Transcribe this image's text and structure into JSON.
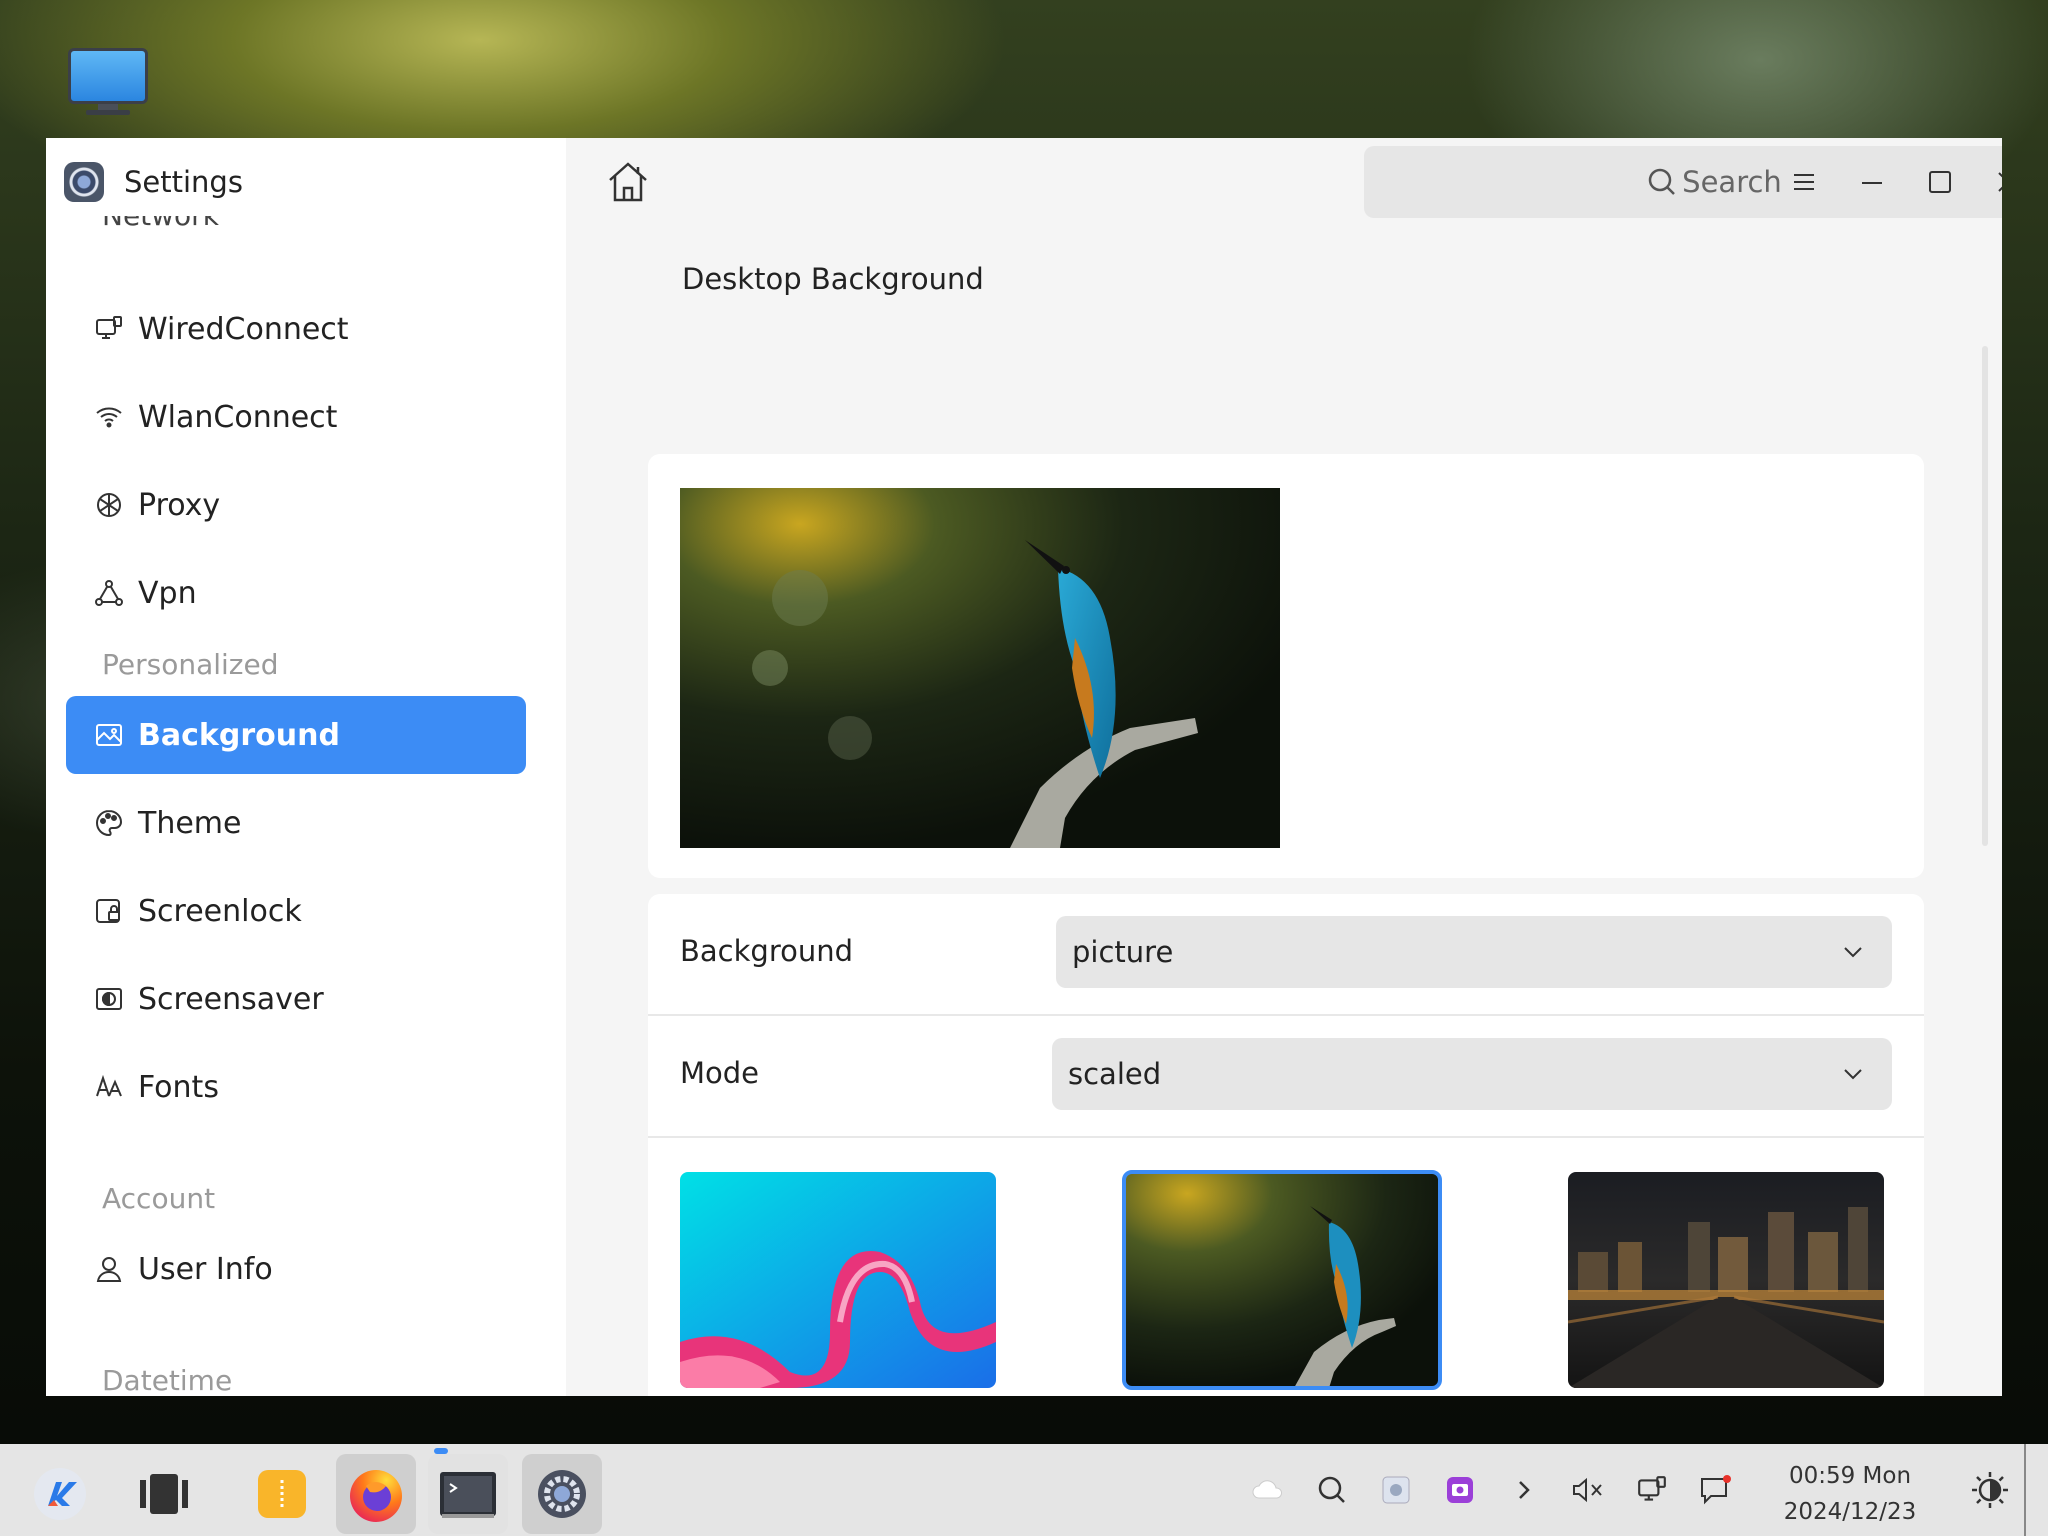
{
  "window": {
    "title": "Settings"
  },
  "search": {
    "placeholder": "Search"
  },
  "sidebar": {
    "cut_item": "Network",
    "items": [
      {
        "label": "WiredConnect",
        "icon": "wired-network-icon"
      },
      {
        "label": "WlanConnect",
        "icon": "wifi-icon"
      },
      {
        "label": "Proxy",
        "icon": "proxy-icon"
      },
      {
        "label": "Vpn",
        "icon": "vpn-icon"
      }
    ],
    "section_personalized": "Personalized",
    "personalized": [
      {
        "label": "Background",
        "icon": "image-icon",
        "active": true
      },
      {
        "label": "Theme",
        "icon": "palette-icon"
      },
      {
        "label": "Screenlock",
        "icon": "screenlock-icon"
      },
      {
        "label": "Screensaver",
        "icon": "screensaver-icon"
      },
      {
        "label": "Fonts",
        "icon": "fonts-icon"
      }
    ],
    "section_account": "Account",
    "account": [
      {
        "label": "User Info",
        "icon": "user-icon"
      }
    ],
    "section_datetime": "Datetime"
  },
  "content": {
    "title": "Desktop Background",
    "background_label": "Background",
    "background_value": "picture",
    "mode_label": "Mode",
    "mode_value": "scaled",
    "thumbnails": [
      {
        "name": "pink-ribbon-wallpaper"
      },
      {
        "name": "kingfisher-wallpaper",
        "selected": true
      },
      {
        "name": "city-night-wallpaper"
      }
    ]
  },
  "taskbar": {
    "time": "00:59 Mon",
    "date": "2024/12/23",
    "accent": "#3c8cf5"
  }
}
